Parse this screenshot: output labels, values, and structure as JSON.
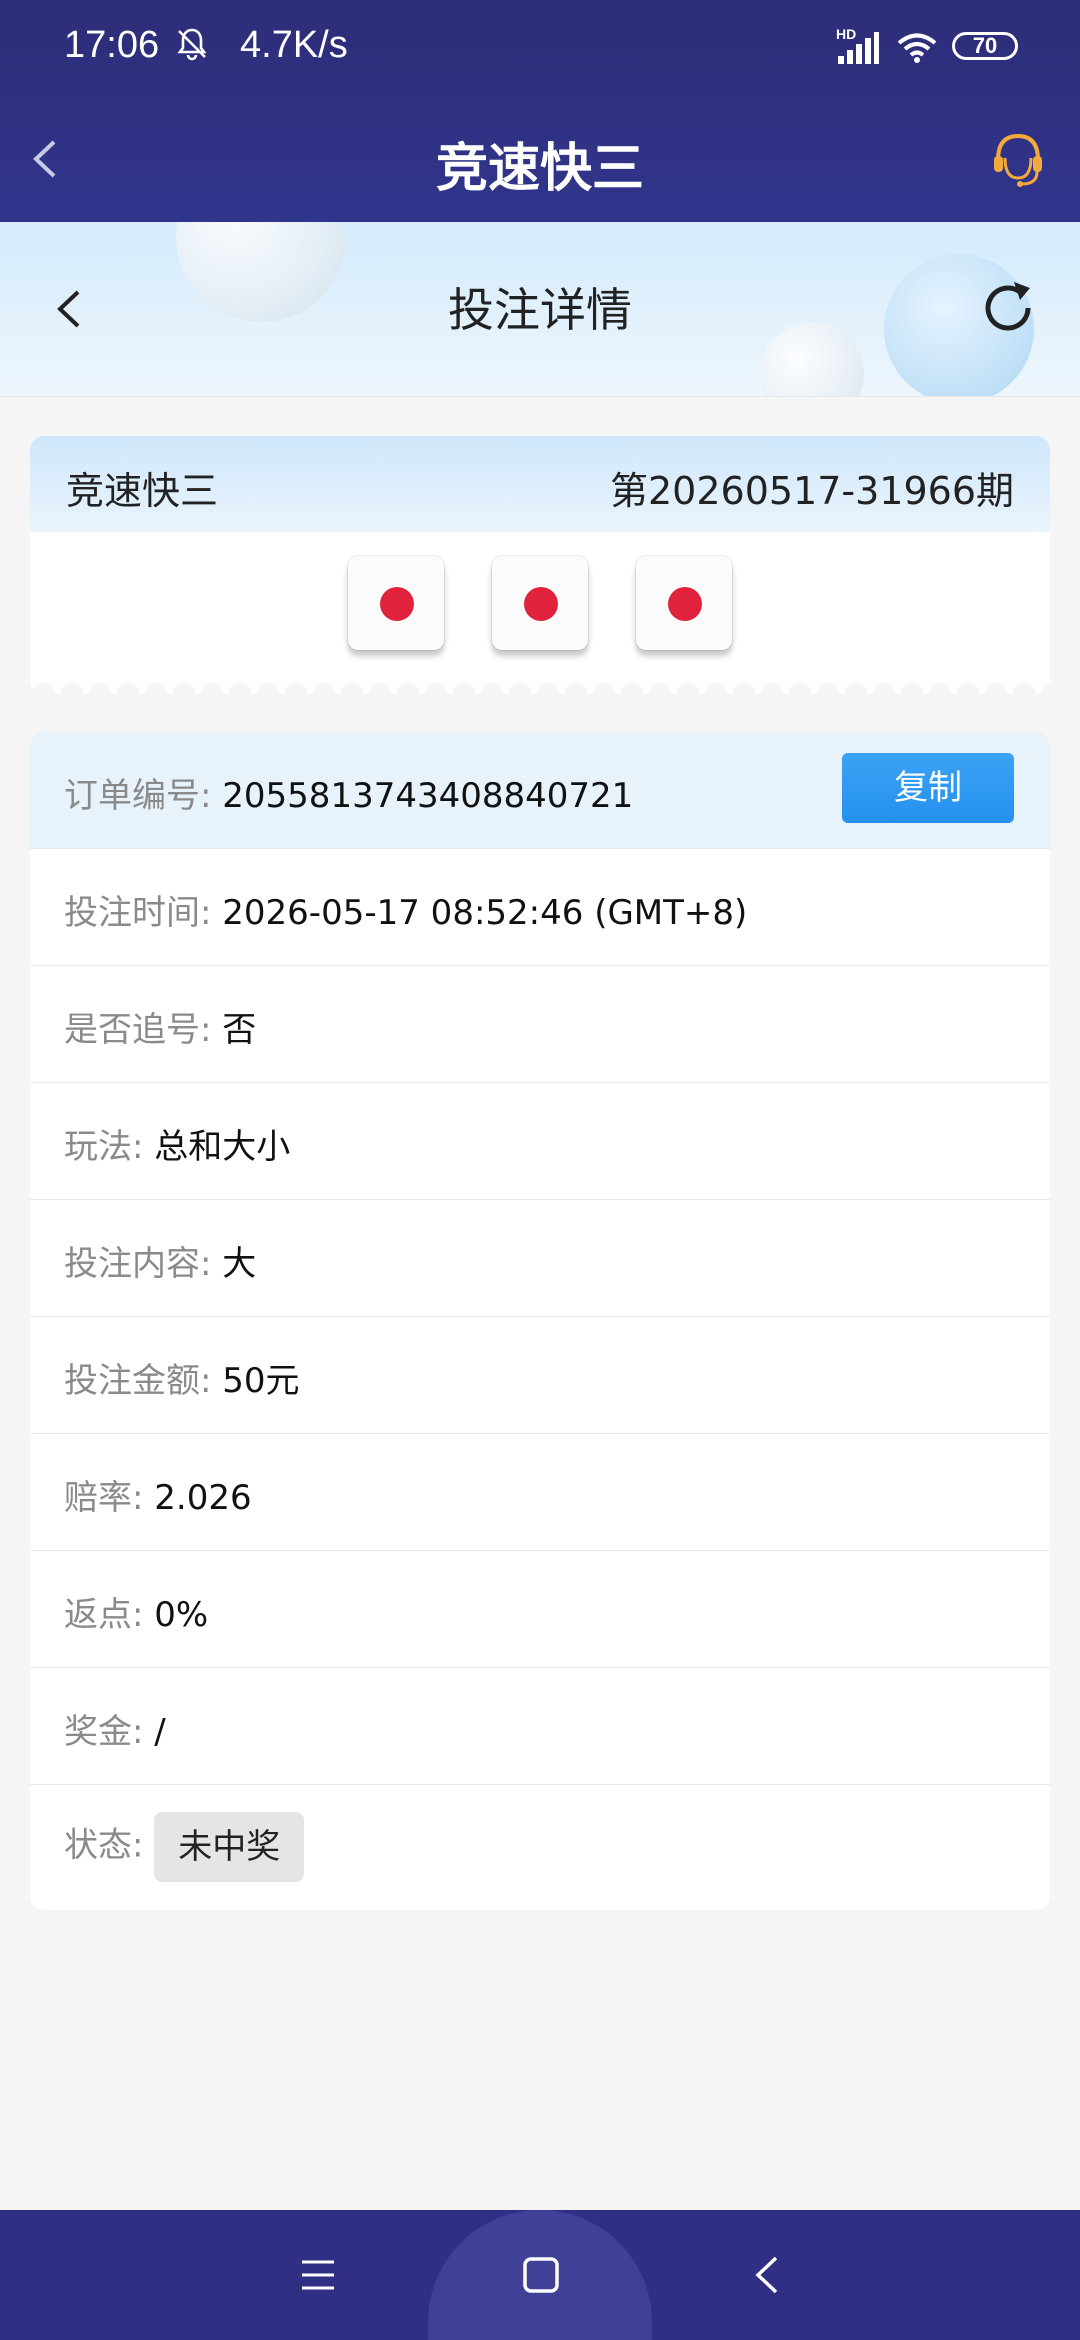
{
  "status_bar": {
    "time": "17:06",
    "network_speed": "4.7K/s",
    "network_type": "HD",
    "battery": "70"
  },
  "app_bar": {
    "title": "竞速快三"
  },
  "page_header": {
    "title": "投注详情"
  },
  "draw_card": {
    "game_name": "竞速快三",
    "period": "第20260517-31966期",
    "dice": [
      1,
      1,
      1
    ],
    "pip_color": "#e0223d"
  },
  "details": {
    "order": {
      "label": "订单编号:",
      "value": "2055813743408840721",
      "copy_label": "复制"
    },
    "bet_time": {
      "label": "投注时间:",
      "value": "2026-05-17 08:52:46 (GMT+8)"
    },
    "chase": {
      "label": "是否追号:",
      "value": "否"
    },
    "play": {
      "label": "玩法:",
      "value": "总和大小"
    },
    "content": {
      "label": "投注内容:",
      "value": "大"
    },
    "amount": {
      "label": "投注金额:",
      "value": "50元"
    },
    "odds": {
      "label": "赔率:",
      "value": "2.026"
    },
    "rebate": {
      "label": "返点:",
      "value": "0%"
    },
    "prize": {
      "label": "奖金:",
      "value": "/"
    },
    "status": {
      "label": "状态:",
      "value": "未中奖"
    }
  },
  "colors": {
    "header_bg": "#2e2d78",
    "accent_blue": "#2590ee",
    "pip_red": "#e0223d"
  }
}
